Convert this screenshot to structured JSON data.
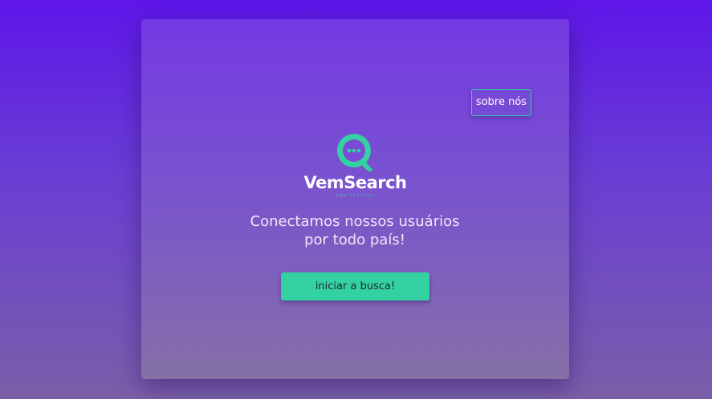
{
  "header": {
    "about_label": "sobre nós"
  },
  "brand": {
    "name": "VemSearch",
    "tagline_small": "application",
    "icon": "search-chat-icon",
    "accent_color": "#34d1a2"
  },
  "hero": {
    "line1": "Conectamos nossos usuários",
    "line2": "por todo país!"
  },
  "cta": {
    "label": "iniciar a busca!",
    "color": "#34d1a2"
  }
}
